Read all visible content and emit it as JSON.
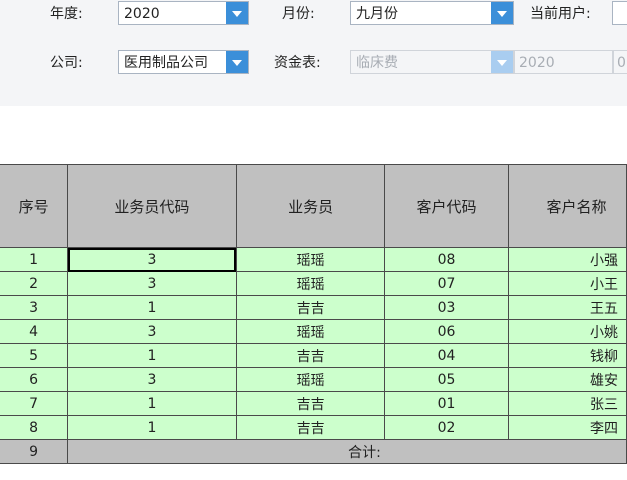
{
  "filters": {
    "year_label": "年度:",
    "year_value": "2020",
    "month_label": "月份:",
    "month_value": "九月份",
    "user_label": "当前用户:",
    "user_value": "",
    "company_label": "公司:",
    "company_value": "医用制品公司",
    "fund_label": "资金表:",
    "fund_value": "临床费",
    "fund_year": "2020",
    "fund_extra": "0"
  },
  "table": {
    "headers": [
      "序号",
      "业务员代码",
      "业务员",
      "客户代码",
      "客户名称"
    ],
    "rows": [
      {
        "seq": "1",
        "rep_code": "3",
        "rep": "瑶瑶",
        "cust_code": "08",
        "cust_name": "小强"
      },
      {
        "seq": "2",
        "rep_code": "3",
        "rep": "瑶瑶",
        "cust_code": "07",
        "cust_name": "小王"
      },
      {
        "seq": "3",
        "rep_code": "1",
        "rep": "吉吉",
        "cust_code": "03",
        "cust_name": "王五"
      },
      {
        "seq": "4",
        "rep_code": "3",
        "rep": "瑶瑶",
        "cust_code": "06",
        "cust_name": "小姚"
      },
      {
        "seq": "5",
        "rep_code": "1",
        "rep": "吉吉",
        "cust_code": "04",
        "cust_name": "钱柳"
      },
      {
        "seq": "6",
        "rep_code": "3",
        "rep": "瑶瑶",
        "cust_code": "05",
        "cust_name": "雄安"
      },
      {
        "seq": "7",
        "rep_code": "1",
        "rep": "吉吉",
        "cust_code": "01",
        "cust_name": "张三"
      },
      {
        "seq": "8",
        "rep_code": "1",
        "rep": "吉吉",
        "cust_code": "02",
        "cust_name": "李四"
      }
    ],
    "total_seq": "9",
    "total_label": "合计:"
  }
}
